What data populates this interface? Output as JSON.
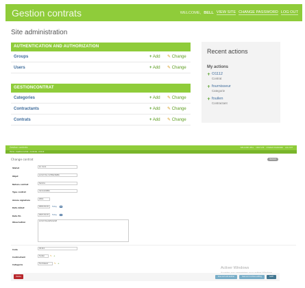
{
  "header": {
    "brand": "Gestion contrats",
    "welcome": "WELCOME,",
    "username": "BELL",
    "view_site": "VIEW SITE",
    "change_password": "CHANGE PASSWORD",
    "log_out": "LOG OUT"
  },
  "page_title": "Site administration",
  "add_label": "Add",
  "change_label": "Change",
  "modules": [
    {
      "caption": "AUTHENTICATION AND AUTHORIZATION",
      "models": [
        "Groups",
        "Users"
      ]
    },
    {
      "caption": "GESTIONCONTRAT",
      "models": [
        "Categories",
        "Contractants",
        "Contrats"
      ]
    }
  ],
  "recent": {
    "title": "Recent actions",
    "subtitle": "My actions",
    "items": [
      {
        "name": "O1112",
        "type": "Contrat"
      },
      {
        "name": "fournisseur",
        "type": "Categorie"
      },
      {
        "name": "fouilen",
        "type": "Contractant"
      }
    ]
  },
  "form": {
    "brand": "Gestion contrats",
    "tools": [
      "WELCOME, BELL",
      "VIEW SITE",
      "CHANGE PASSWORD",
      "LOG OUT"
    ],
    "breadcrumb": "Home › Gestioncontrat › Contrats › O1112",
    "title": "Change contrat",
    "history": "HISTORY",
    "today": "Today",
    "fields": [
      {
        "label": "Statut",
        "value": "en cours"
      },
      {
        "label": "Objet",
        "value": "accord de confidentialité"
      },
      {
        "label": "Nature contrat",
        "value": "Service"
      },
      {
        "label": "Type contrat",
        "value": "renouvelable"
      },
      {
        "label": "Année signature",
        "value": "2019"
      },
      {
        "label": "Date début",
        "value": "2019-01-01"
      },
      {
        "label": "Date fin",
        "value": "2021-01-01"
      },
      {
        "label": "Observation",
        "value": "accord de partenariat"
      }
    ],
    "fields2": [
      {
        "label": "Code",
        "value": "O1112"
      },
      {
        "label": "Contractant",
        "value": "fouilen"
      },
      {
        "label": "Categorie",
        "value": "fournisseur"
      }
    ],
    "buttons": {
      "delete": "Delete",
      "save_add": "Save and add another",
      "save_continue": "Save and continue editing",
      "save": "SAVE"
    },
    "watermark_title": "Activer Windows",
    "watermark_sub": "Accédez aux paramètres pour activer Windows."
  }
}
